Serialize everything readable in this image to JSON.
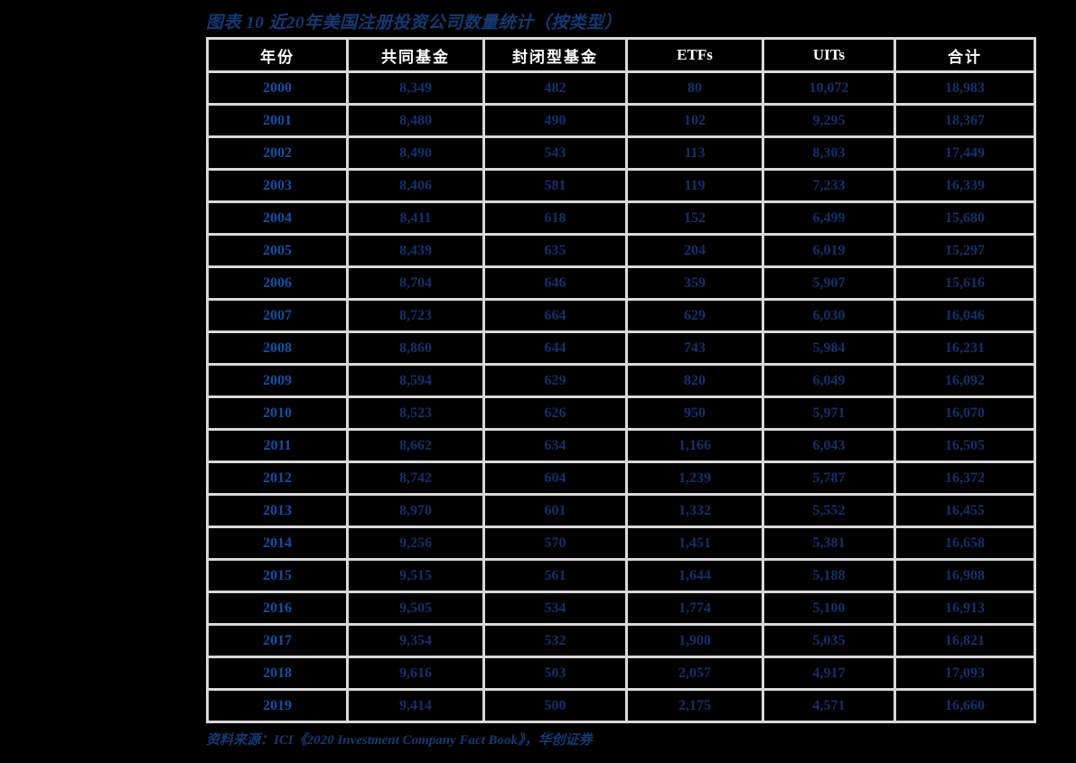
{
  "title": "图表 10   近20年美国注册投资公司数量统计（按类型）",
  "source_note": "资料来源：ICI《2020 Investment Company Fact Book》，华创证券",
  "colors": {
    "header_background": "#0f4180",
    "header_text": "#ffffff",
    "year_text": "#0f4fa8",
    "value_text": "#12316b",
    "title_text": "#123a74",
    "grid_line": "#d9d9d9",
    "page_background": "#000000"
  },
  "chart_data": {
    "type": "table",
    "title": "图表 10   近20年美国注册投资公司数量统计（按类型）",
    "columns": [
      "年份",
      "共同基金",
      "封闭型基金",
      "ETFs",
      "UITs",
      "合计"
    ],
    "rows": [
      [
        "2000",
        "8,349",
        "482",
        "80",
        "10,072",
        "18,983"
      ],
      [
        "2001",
        "8,480",
        "490",
        "102",
        "9,295",
        "18,367"
      ],
      [
        "2002",
        "8,490",
        "543",
        "113",
        "8,303",
        "17,449"
      ],
      [
        "2003",
        "8,406",
        "581",
        "119",
        "7,233",
        "16,339"
      ],
      [
        "2004",
        "8,411",
        "618",
        "152",
        "6,499",
        "15,680"
      ],
      [
        "2005",
        "8,439",
        "635",
        "204",
        "6,019",
        "15,297"
      ],
      [
        "2006",
        "8,704",
        "646",
        "359",
        "5,907",
        "15,616"
      ],
      [
        "2007",
        "8,723",
        "664",
        "629",
        "6,030",
        "16,046"
      ],
      [
        "2008",
        "8,860",
        "644",
        "743",
        "5,984",
        "16,231"
      ],
      [
        "2009",
        "8,594",
        "629",
        "820",
        "6,049",
        "16,092"
      ],
      [
        "2010",
        "8,523",
        "626",
        "950",
        "5,971",
        "16,070"
      ],
      [
        "2011",
        "8,662",
        "634",
        "1,166",
        "6,043",
        "16,505"
      ],
      [
        "2012",
        "8,742",
        "604",
        "1,239",
        "5,787",
        "16,372"
      ],
      [
        "2013",
        "8,970",
        "601",
        "1,332",
        "5,552",
        "16,455"
      ],
      [
        "2014",
        "9,256",
        "570",
        "1,451",
        "5,381",
        "16,658"
      ],
      [
        "2015",
        "9,515",
        "561",
        "1,644",
        "5,188",
        "16,908"
      ],
      [
        "2016",
        "9,505",
        "534",
        "1,774",
        "5,100",
        "16,913"
      ],
      [
        "2017",
        "9,354",
        "532",
        "1,900",
        "5,035",
        "16,821"
      ],
      [
        "2018",
        "9,616",
        "503",
        "2,057",
        "4,917",
        "17,093"
      ],
      [
        "2019",
        "9,414",
        "500",
        "2,175",
        "4,571",
        "16,660"
      ]
    ]
  }
}
